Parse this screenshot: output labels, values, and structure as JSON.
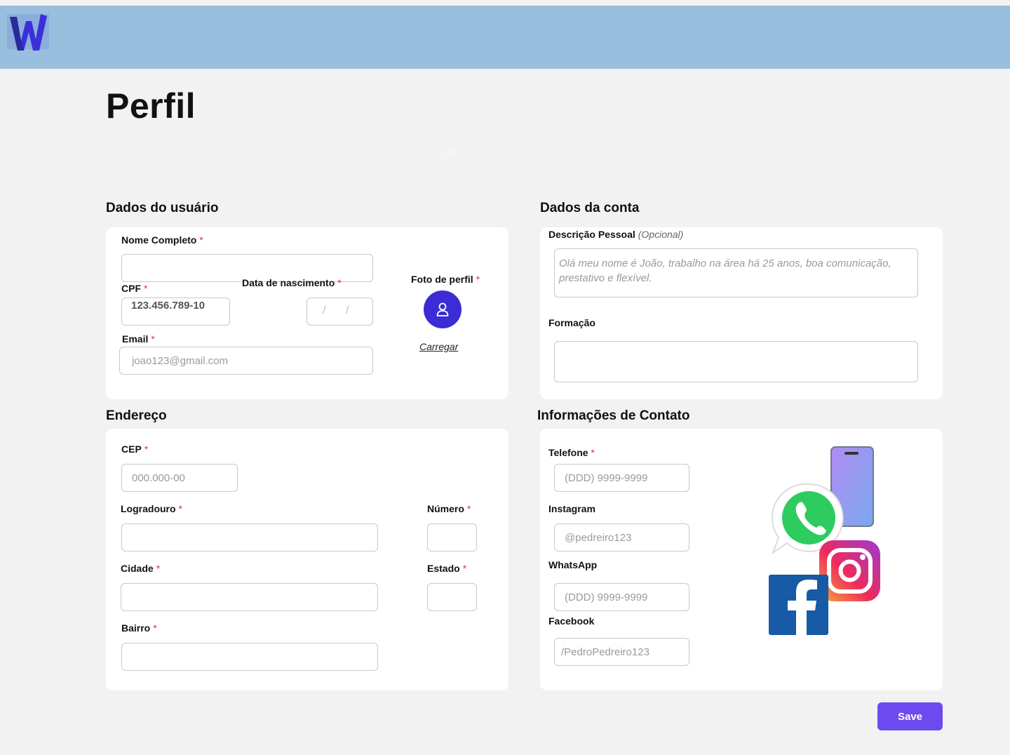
{
  "colors": {
    "header_bg": "#99bfdf",
    "page_bg": "#f2f2f2",
    "required": "#e0343f",
    "avatar_bg": "#3b2cd6",
    "save_bg": "#6d4af0"
  },
  "header": {
    "logo_icon": "w-logo-icon"
  },
  "page": {
    "title": "Perfil",
    "ghost_label": "API"
  },
  "user_data": {
    "title": "Dados do usuário",
    "full_name": {
      "label": "Nome Completo",
      "required": "*",
      "value": ""
    },
    "cpf": {
      "label": "CPF",
      "required": "*",
      "value": "123.456.789-10"
    },
    "birth_date": {
      "label": "Data de nascimento",
      "required": "*",
      "sep1": "/",
      "sep2": "/"
    },
    "email": {
      "label": "Email",
      "required": "*",
      "placeholder": "joao123@gmail.com"
    },
    "photo": {
      "label": "Foto de perfil",
      "required": "*",
      "upload": "Carregar",
      "icon": "user-icon"
    }
  },
  "account": {
    "title": "Dados da conta",
    "description": {
      "label": "Descrição Pessoal",
      "optional": "(Opcional)",
      "placeholder": "Olá meu nome é João, trabalho na área há 25 anos, boa comunicação, prestativo e flexível."
    },
    "education": {
      "label": "Formação",
      "value": ""
    }
  },
  "address": {
    "title": "Endereço",
    "cep": {
      "label": "CEP",
      "required": "*",
      "placeholder": "000.000-00"
    },
    "street": {
      "label": "Logradouro",
      "required": "*"
    },
    "number": {
      "label": "Número",
      "required": "*"
    },
    "city": {
      "label": "Cidade",
      "required": "*"
    },
    "state": {
      "label": "Estado",
      "required": "*"
    },
    "district": {
      "label": "Bairro",
      "required": "*"
    }
  },
  "contact": {
    "title": "Informações de Contato",
    "phone": {
      "label": "Telefone",
      "required": "*",
      "placeholder": "(DDD) 9999-9999"
    },
    "instagram": {
      "label": "Instagram",
      "placeholder": "@pedreiro123"
    },
    "whatsapp": {
      "label": "WhatsApp",
      "placeholder": "(DDD) 9999-9999"
    },
    "facebook": {
      "label": "Facebook",
      "placeholder": "/PedroPedreiro123"
    },
    "illustration_icons": [
      "phone-icon",
      "whatsapp-icon",
      "instagram-icon",
      "facebook-icon"
    ]
  },
  "actions": {
    "save": "Save"
  }
}
